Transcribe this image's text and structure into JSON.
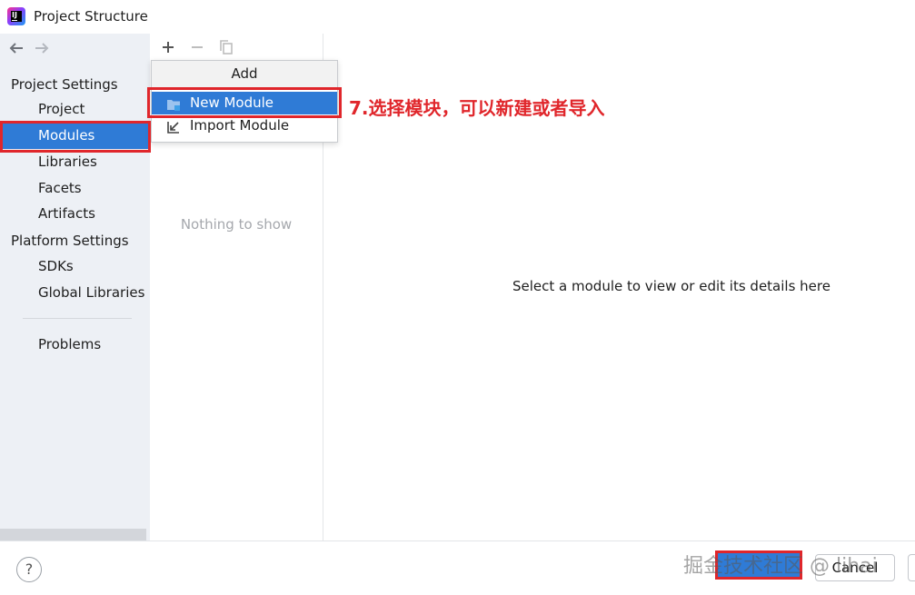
{
  "window": {
    "title": "Project Structure"
  },
  "nav": {
    "back_icon": "arrow-left-icon",
    "forward_icon": "arrow-right-icon"
  },
  "sidebar": {
    "project_settings_header": "Project Settings",
    "project_items": [
      {
        "label": "Project",
        "selected": false
      },
      {
        "label": "Modules",
        "selected": true
      },
      {
        "label": "Libraries",
        "selected": false
      },
      {
        "label": "Facets",
        "selected": false
      },
      {
        "label": "Artifacts",
        "selected": false
      }
    ],
    "platform_settings_header": "Platform Settings",
    "platform_items": [
      {
        "label": "SDKs"
      },
      {
        "label": "Global Libraries"
      }
    ],
    "problems_label": "Problems"
  },
  "modules_panel": {
    "toolbar": {
      "add_icon": "plus-icon",
      "remove_icon": "minus-icon",
      "copy_icon": "copy-icon"
    },
    "empty_text": "Nothing to show"
  },
  "add_popup": {
    "header": "Add",
    "items": [
      {
        "label": "New Module",
        "icon": "folder-module-icon",
        "selected": true
      },
      {
        "label": "Import Module",
        "icon": "import-icon",
        "selected": false
      }
    ]
  },
  "details": {
    "placeholder": "Select a module to view or edit its details here"
  },
  "annotation": {
    "text": "7.选择模块，可以新建或者导入",
    "color": "#e0262b"
  },
  "footer": {
    "help_label": "?",
    "cancel_label": "Cancel"
  },
  "watermark": "掘金技术社区 @ lihai",
  "colors": {
    "selection": "#2f7bd6",
    "sidebar_bg": "#edf0f5",
    "highlight": "#e0262b"
  }
}
